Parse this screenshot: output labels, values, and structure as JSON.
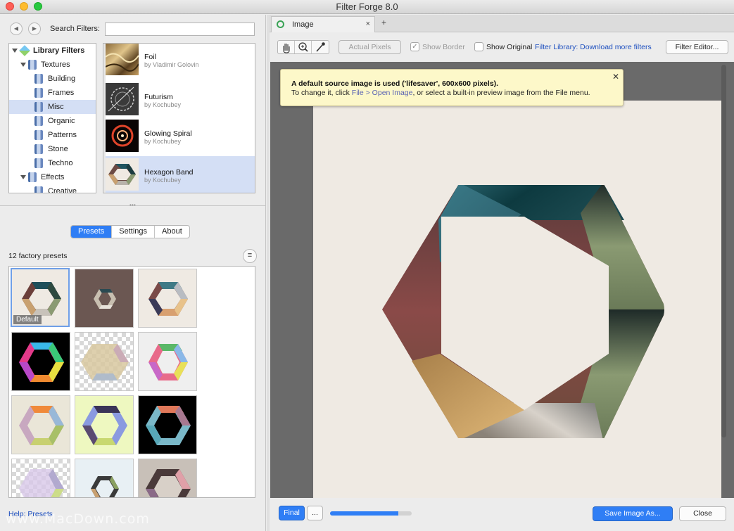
{
  "window": {
    "title": "Filter Forge 8.0"
  },
  "left": {
    "search_label": "Search Filters:",
    "search_value": "",
    "tree": [
      {
        "label": "Library Filters",
        "icon": "library-cube-icon",
        "level": 0,
        "bold": true
      },
      {
        "label": "Textures",
        "icon": "folder-icon",
        "level": 1,
        "expanded": true
      },
      {
        "label": "Building",
        "icon": "folder-icon",
        "level": 2
      },
      {
        "label": "Frames",
        "icon": "folder-icon",
        "level": 2
      },
      {
        "label": "Misc",
        "icon": "folder-icon",
        "level": 2,
        "selected": true
      },
      {
        "label": "Organic",
        "icon": "folder-icon",
        "level": 2
      },
      {
        "label": "Patterns",
        "icon": "folder-icon",
        "level": 2
      },
      {
        "label": "Stone",
        "icon": "folder-icon",
        "level": 2
      },
      {
        "label": "Techno",
        "icon": "folder-icon",
        "level": 2
      },
      {
        "label": "Effects",
        "icon": "folder-icon",
        "level": 1,
        "expanded": true
      },
      {
        "label": "Creative",
        "icon": "folder-icon",
        "level": 2
      }
    ],
    "filters": [
      {
        "name": "Foil",
        "author": "by Vladimir Golovin"
      },
      {
        "name": "Futurism",
        "author": "by Kochubey"
      },
      {
        "name": "Glowing Spiral",
        "author": "by Kochubey"
      },
      {
        "name": "Hexagon Band",
        "author": "by Kochubey",
        "selected": true
      }
    ],
    "tabs": {
      "presets": "Presets",
      "settings": "Settings",
      "about": "About",
      "active": "Presets"
    },
    "preset_count": "12 factory presets",
    "default_label": "Default",
    "help_link": "Help: Presets",
    "watermark": "www.MacDown.com"
  },
  "image": {
    "tab_label": "Image",
    "tab_close": "×",
    "tab_add": "+",
    "toolbar": {
      "actual_pixels": "Actual Pixels",
      "show_border": "Show Border",
      "show_border_checked": true,
      "show_original": "Show Original",
      "show_original_checked": false,
      "library_link": "Filter Library: Download more filters",
      "filter_editor": "Filter Editor..."
    },
    "notice": {
      "line1": "A default source image is used ('lifesaver', 600x600 pixels).",
      "line2_a": "To change it, click ",
      "line2_link": "File > Open Image",
      "line2_b": ", or select a built-in preview image from the File menu."
    },
    "bottom": {
      "final": "Final",
      "more": "...",
      "progress": 0.84,
      "save": "Save Image As...",
      "close": "Close"
    }
  },
  "colors": {
    "accent": "#2f7ef5",
    "selection": "#d4dff5",
    "notice_bg": "#fdf8c9",
    "link": "#1d4fbf"
  }
}
